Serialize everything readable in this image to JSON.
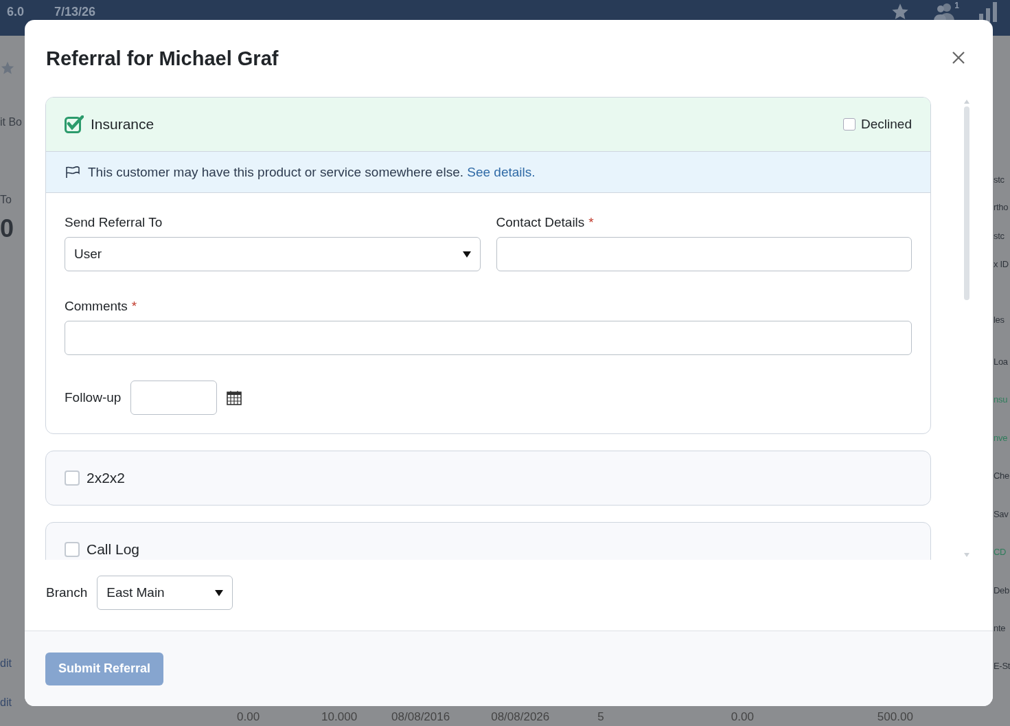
{
  "topbar": {
    "version": "6.0",
    "date": "7/13/26",
    "notification_count": "1"
  },
  "background": {
    "left_items": [
      {
        "kind": "star"
      },
      {
        "kind": "text",
        "label": "it Bo"
      },
      {
        "kind": "text",
        "label": "To"
      },
      {
        "kind": "big",
        "label": "0"
      },
      {
        "kind": "link",
        "label": "dit"
      },
      {
        "kind": "link",
        "label": "dit"
      }
    ],
    "right_items": [
      {
        "label": "stc"
      },
      {
        "label": "rtho"
      },
      {
        "label": "stc"
      },
      {
        "label": "x ID"
      },
      {
        "label": "les"
      },
      {
        "label": "Loa"
      },
      {
        "label": "nsu",
        "color": "#2e7d5b"
      },
      {
        "label": "nve",
        "color": "#2e7d5b"
      },
      {
        "label": "Che"
      },
      {
        "label": "Sav"
      },
      {
        "label": "CD",
        "color": "#2e7d5b"
      },
      {
        "label": "Deb"
      },
      {
        "label": "nte"
      },
      {
        "label": "E-St"
      }
    ],
    "table_row": [
      "0.00",
      "10.000",
      "08/08/2016",
      "08/08/2026",
      "5",
      "0.00",
      "500.00"
    ]
  },
  "modal": {
    "title": "Referral for Michael Graf",
    "products": [
      {
        "label": "Insurance",
        "checked": true,
        "expanded": true,
        "declined": {
          "label": "Declined",
          "checked": false
        },
        "alert": {
          "text": "This customer may have this product or service somewhere else.",
          "link": "See details."
        },
        "send_referral_to": {
          "label": "Send Referral To",
          "value": "User"
        },
        "contact_details": {
          "label": "Contact Details",
          "required_mark": "*"
        },
        "comments": {
          "label": "Comments",
          "required_mark": "*"
        },
        "follow_up": {
          "label": "Follow-up"
        }
      },
      {
        "label": "2x2x2",
        "checked": false,
        "expanded": false
      },
      {
        "label": "Call Log",
        "checked": false,
        "expanded": false
      }
    ],
    "branch": {
      "label": "Branch",
      "value": "East Main"
    },
    "submit": {
      "label": "Submit Referral",
      "disabled": true
    }
  }
}
